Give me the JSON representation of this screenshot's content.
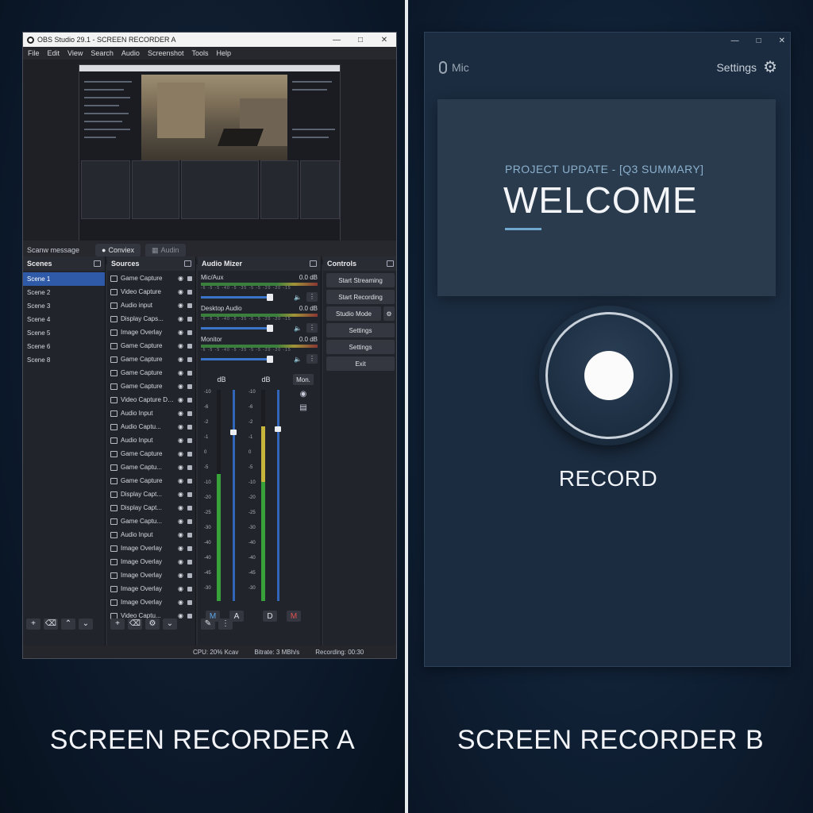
{
  "recorder_a": {
    "caption": "SCREEN RECORDER A",
    "window_title": "OBS Studio 29.1 - SCREEN RECORDER A",
    "menu": [
      "File",
      "Edit",
      "View",
      "Search",
      "Audio",
      "Screenshot",
      "Tools",
      "Help"
    ],
    "status_message": "Scanw message",
    "chip_connect": "Conviex",
    "chip_audio": "Audin",
    "scenes": {
      "title": "Scenes",
      "items": [
        "Scene 1",
        "Scene 2",
        "Scene 3",
        "Scene 4",
        "Scene 5",
        "Scene 6",
        "Scene 8"
      ],
      "selected": "Scene 1"
    },
    "sources": {
      "title": "Sources",
      "items": [
        "Game Capture",
        "Video Capture",
        "Audio input",
        "Display Caps...",
        "Image Overlay",
        "Game Capture",
        "Game Capture",
        "Game Capture",
        "Game Capture",
        "Video Capture Device",
        "Audio Input",
        "Audio Captu...",
        "Audio Input",
        "Game Capture",
        "Game Captu...",
        "Game Capture",
        "Display Capt...",
        "Display Capt...",
        "Game Captu...",
        "Audio Input",
        "Image Overlay",
        "Image Overlay",
        "Image Overlay",
        "Image Overlay",
        "Image Overlay",
        "Video Captu..."
      ]
    },
    "mixer": {
      "title": "Audio Mizer",
      "channels": [
        {
          "name": "Mic/Aux",
          "db": "0.0 dB",
          "level": 0.8
        },
        {
          "name": "Desktop Audio",
          "db": "0.0 dB",
          "level": 0.8
        },
        {
          "name": "Monitor",
          "db": "0.0 dB",
          "level": 0.8
        }
      ],
      "scale_ticks": "-6  -5  -5  -40  -5  -35  -5  -5  -20  -20  -15",
      "vu_label": "dB",
      "vu_scale": [
        "-10",
        "-6",
        "-2",
        "-1",
        "0",
        "-5",
        "-10",
        "-20",
        "-25",
        "-30",
        "-40",
        "-40",
        "-45",
        "-30"
      ],
      "mon_button": "Mon.",
      "foot_buttons": [
        "M",
        "A",
        "D",
        "M"
      ]
    },
    "controls": {
      "title": "Controls",
      "buttons": [
        "Start Streaming",
        "Start Recording",
        "Studio Mode",
        "Settings",
        "Settings",
        "Exit"
      ]
    },
    "statusbar": {
      "cpu": "CPU: 20% Kcav",
      "bitrate": "Bitrate: 3 MBh/s",
      "recording": "Recording: 00:30"
    }
  },
  "recorder_b": {
    "caption": "SCREEN RECORDER B",
    "mic_label": "Mic",
    "settings_label": "Settings",
    "card_subtitle": "PROJECT UPDATE - [Q3 SUMMARY]",
    "card_title": "WELCOME",
    "record_label": "RECORD"
  }
}
